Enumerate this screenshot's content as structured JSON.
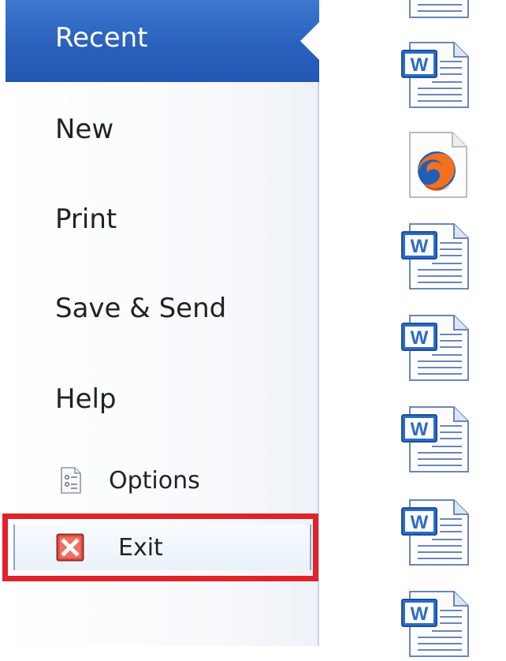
{
  "menu": {
    "items": [
      {
        "label": "Recent",
        "selected": true
      },
      {
        "label": "New"
      },
      {
        "label": "Print"
      },
      {
        "label": "Save & Send"
      },
      {
        "label": "Help"
      },
      {
        "label": "Options",
        "icon": "options-icon"
      },
      {
        "label": "Exit",
        "icon": "exit-icon",
        "highlighted": true
      }
    ]
  },
  "recent_files": [
    {
      "icon": "word-document-icon"
    },
    {
      "icon": "word-document-icon"
    },
    {
      "icon": "firefox-document-icon"
    },
    {
      "icon": "word-document-icon"
    },
    {
      "icon": "word-document-icon"
    },
    {
      "icon": "word-document-icon"
    },
    {
      "icon": "word-document-icon"
    },
    {
      "icon": "word-document-icon"
    }
  ],
  "colors": {
    "selected_bg": "#2a61bd",
    "highlight_border": "#e0232b",
    "word_blue": "#2b6cc8"
  }
}
